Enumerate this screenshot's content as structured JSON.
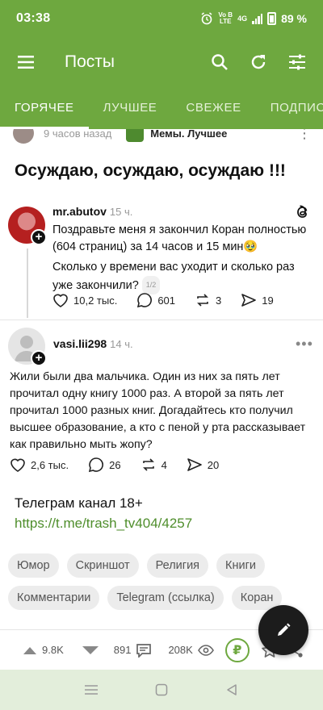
{
  "status_bar": {
    "time": "03:38",
    "network_top": "Vo B",
    "network_bottom": "LTE",
    "network_type": "4G",
    "battery": "89 %"
  },
  "app_bar": {
    "title": "Посты",
    "icons": [
      "menu-icon",
      "search-icon",
      "refresh-icon",
      "filter-icon"
    ]
  },
  "tabs": [
    {
      "label": "ГОРЯЧЕЕ",
      "active": true
    },
    {
      "label": "ЛУЧШЕЕ",
      "active": false
    },
    {
      "label": "СВЕЖЕЕ",
      "active": false
    },
    {
      "label": "ПОДПИСК",
      "active": false
    }
  ],
  "post": {
    "time": "9 часов назад",
    "community": "Мемы. Лучшее",
    "title": "Осуждаю, осуждаю, осуждаю !!!",
    "embed1": {
      "author": "mr.abutov",
      "time": "15 ч.",
      "text": "Поздравьте меня я закончил Коран полностью (604 страниц) за 14 часов и 15 мин🥹",
      "text2": "Сколько у времени вас уходит и сколько раз уже закончили?",
      "pager": "1/2",
      "likes": "10,2 тыс.",
      "comments": "601",
      "reposts": "3",
      "shares": "19"
    },
    "embed2": {
      "author": "vasi.lii298",
      "time": "14 ч.",
      "text": "Жили были два мальчика. Один из них за пять лет прочитал одну книгу 1000 раз. А второй за пять лет прочитал 1000 разных книг. Догадайтесь кто получил высшее образование, а кто с пеной у рта рассказывает как правильно мыть жопу?",
      "likes": "2,6 тыс.",
      "comments": "26",
      "reposts": "4",
      "shares": "20"
    },
    "telegram_title": "Телеграм канал 18+",
    "telegram_link": "https://t.me/trash_tv404/4257",
    "tags": [
      "Юмор",
      "Скриншот",
      "Религия",
      "Книги",
      "Комментарии",
      "Telegram (ссылка)",
      "Коран"
    ]
  },
  "bottom_bar": {
    "rating": "9.8K",
    "comments": "891",
    "views": "208K",
    "donate_symbol": "₽"
  },
  "colors": {
    "brand": "#6ea83f",
    "link": "#4f8e2c",
    "fab": "#1c1c1c"
  }
}
